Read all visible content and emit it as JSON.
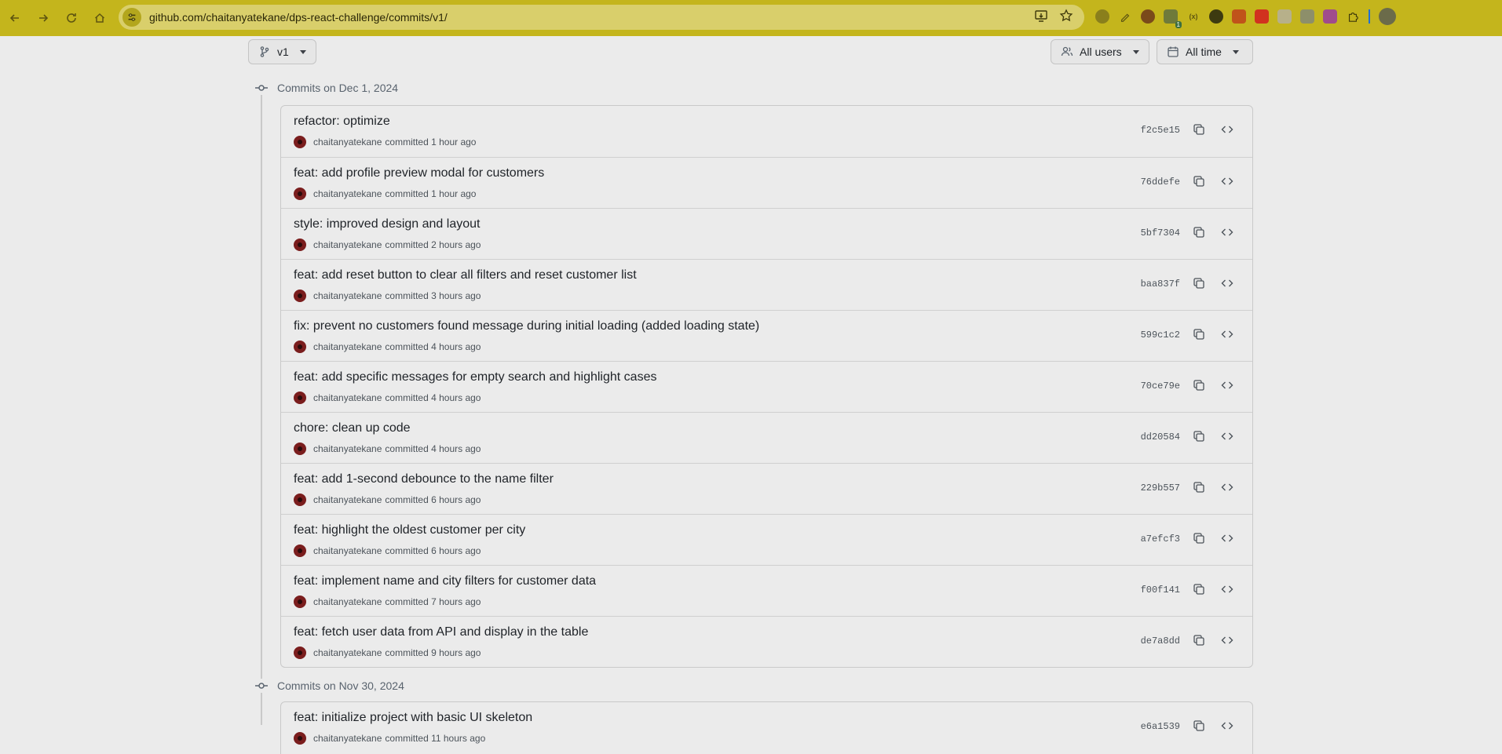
{
  "browser": {
    "url": "github.com/chaitanyatekane/dps-react-challenge/commits/v1/",
    "extension_badge": "1",
    "colors": {
      "chrome": "#c4b51c",
      "omnibox": "#d9cf6b"
    }
  },
  "toolbar": {
    "branch_label": "v1",
    "users_label": "All users",
    "time_label": "All time"
  },
  "groups": [
    {
      "title": "Commits on Dec 1, 2024",
      "commits": [
        {
          "message": "refactor: optimize",
          "author": "chaitanyatekane",
          "meta": "committed 1 hour ago",
          "sha": "f2c5e15"
        },
        {
          "message": "feat: add profile preview modal for customers",
          "author": "chaitanyatekane",
          "meta": "committed 1 hour ago",
          "sha": "76ddefe"
        },
        {
          "message": "style: improved design and layout",
          "author": "chaitanyatekane",
          "meta": "committed 2 hours ago",
          "sha": "5bf7304"
        },
        {
          "message": "feat: add reset button to clear all filters and reset customer list",
          "author": "chaitanyatekane",
          "meta": "committed 3 hours ago",
          "sha": "baa837f"
        },
        {
          "message": "fix: prevent no customers found message during initial loading (added loading state)",
          "author": "chaitanyatekane",
          "meta": "committed 4 hours ago",
          "sha": "599c1c2"
        },
        {
          "message": "feat: add specific messages for empty search and highlight cases",
          "author": "chaitanyatekane",
          "meta": "committed 4 hours ago",
          "sha": "70ce79e"
        },
        {
          "message": "chore: clean up code",
          "author": "chaitanyatekane",
          "meta": "committed 4 hours ago",
          "sha": "dd20584"
        },
        {
          "message": "feat: add 1-second debounce to the name filter",
          "author": "chaitanyatekane",
          "meta": "committed 6 hours ago",
          "sha": "229b557"
        },
        {
          "message": "feat: highlight the oldest customer per city",
          "author": "chaitanyatekane",
          "meta": "committed 6 hours ago",
          "sha": "a7efcf3"
        },
        {
          "message": "feat: implement name and city filters for customer data",
          "author": "chaitanyatekane",
          "meta": "committed 7 hours ago",
          "sha": "f00f141"
        },
        {
          "message": "feat: fetch user data from API and display in the table",
          "author": "chaitanyatekane",
          "meta": "committed 9 hours ago",
          "sha": "de7a8dd"
        }
      ]
    },
    {
      "title": "Commits on Nov 30, 2024",
      "commits": [
        {
          "message": "feat: initialize project with basic UI skeleton",
          "author": "chaitanyatekane",
          "meta": "committed 11 hours ago",
          "sha": "e6a1539"
        }
      ]
    }
  ]
}
